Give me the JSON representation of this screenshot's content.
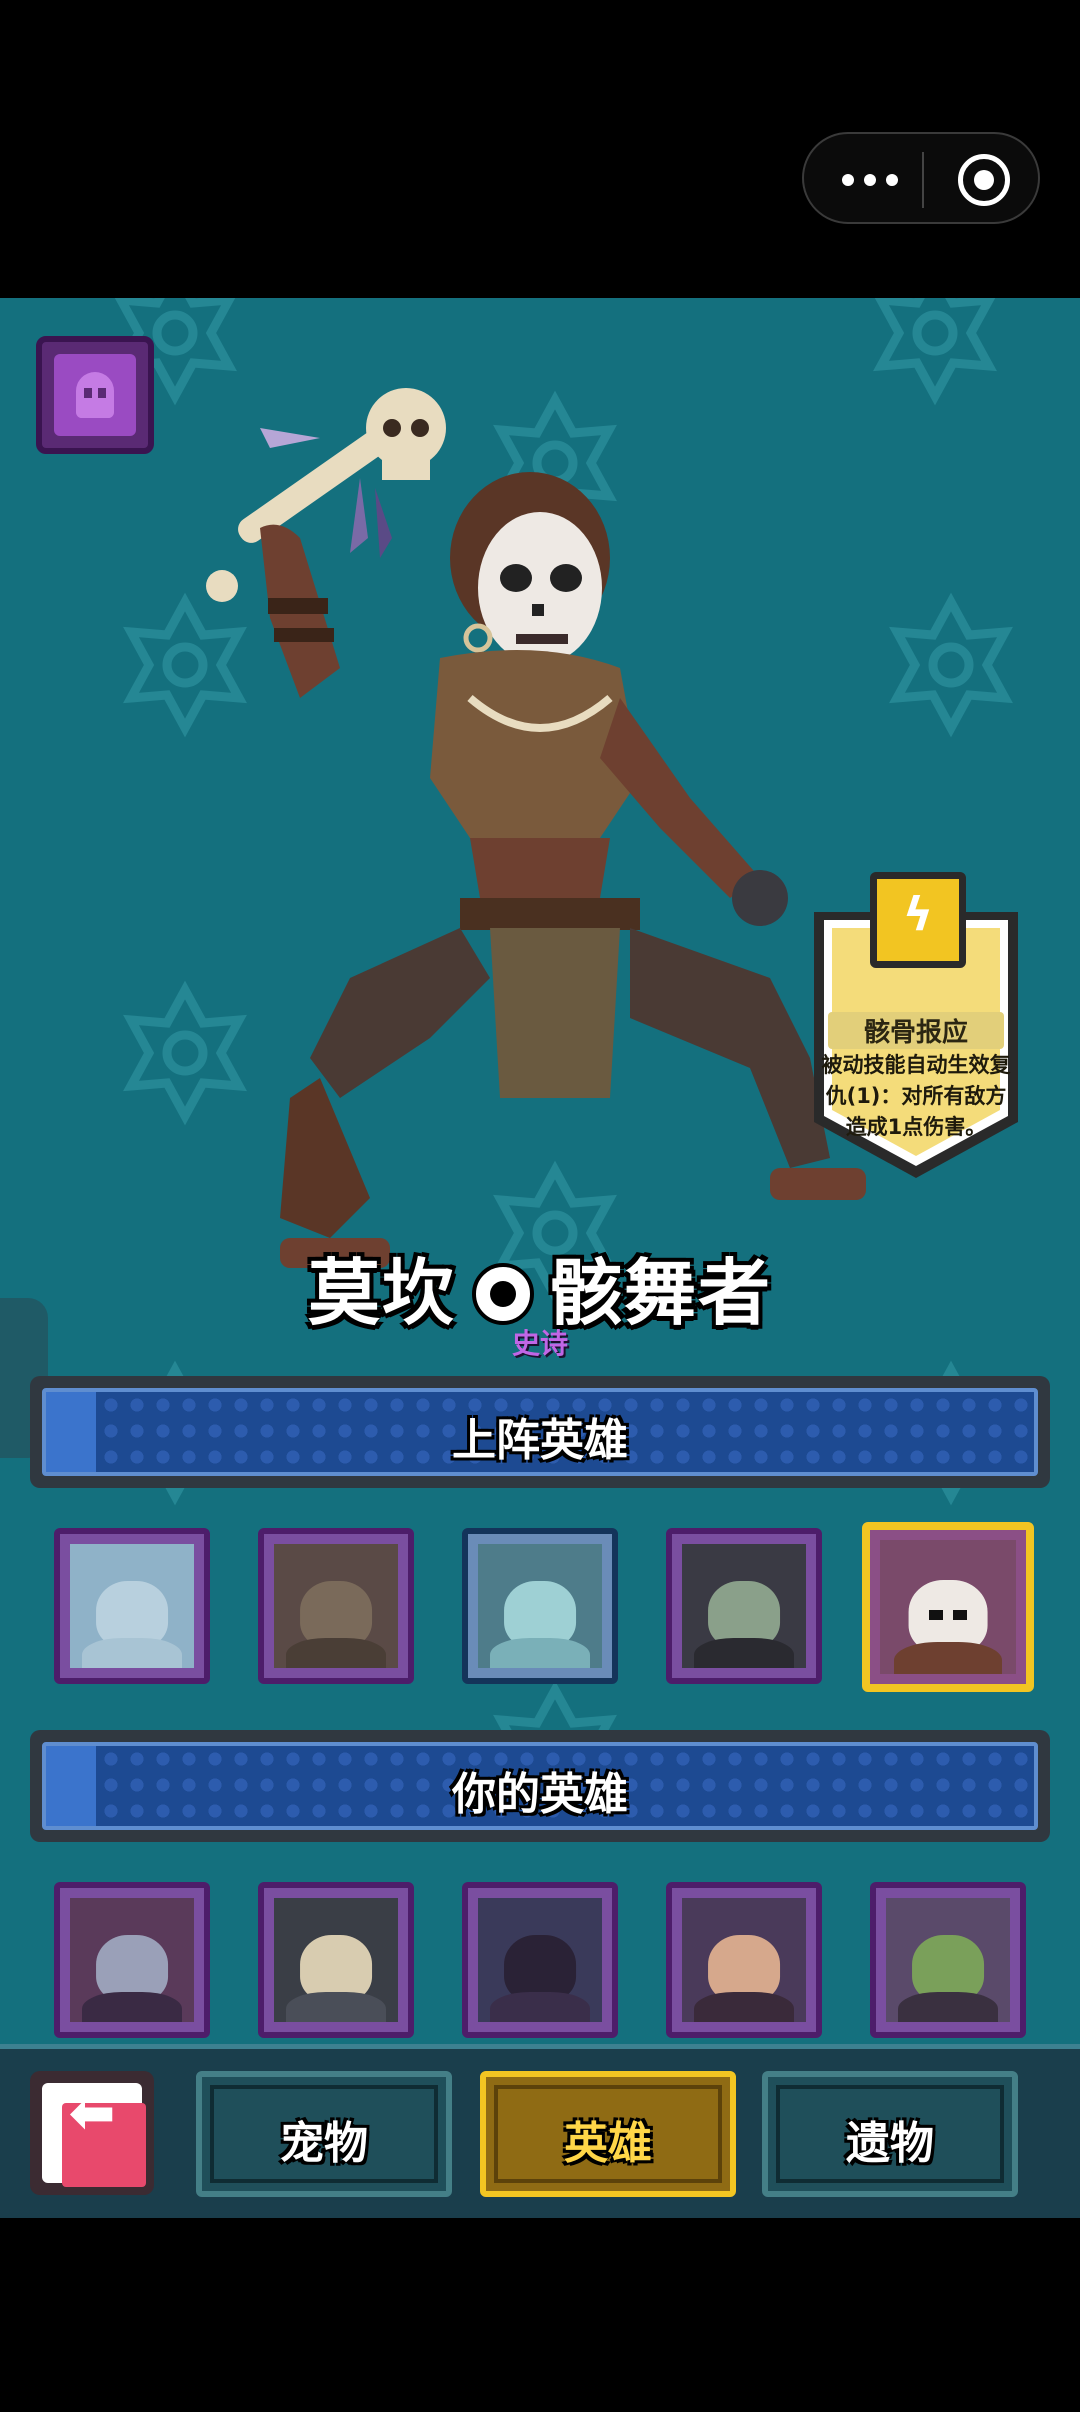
{
  "system_bar": {
    "more_icon": "more-dots-icon",
    "close_icon": "target-circle-icon"
  },
  "hero": {
    "name_part1": "莫坎",
    "name_part2": "骸舞者",
    "rarity": "史诗",
    "rarity_color": "#c066e6"
  },
  "skill": {
    "icon": "lightning-icon",
    "name": "骸骨报应",
    "description": "被动技能自动生效复仇(1)：对所有敌方造成1点伤害。"
  },
  "sections": {
    "deployed_title": "上阵英雄",
    "owned_title": "你的英雄"
  },
  "deployed_heroes": [
    {
      "id": "ghost-samurai",
      "frame": "purple",
      "selected": false
    },
    {
      "id": "horned-skeleton-warrior",
      "frame": "purple",
      "selected": false
    },
    {
      "id": "ghost-old-man",
      "frame": "blue",
      "selected": false
    },
    {
      "id": "vampire",
      "frame": "purple",
      "selected": false
    },
    {
      "id": "bone-dancer",
      "frame": "gold",
      "selected": true
    }
  ],
  "owned_heroes": [
    {
      "id": "dark-elf-woman",
      "frame": "purple"
    },
    {
      "id": "skeleton-knight",
      "frame": "purple"
    },
    {
      "id": "hooded-wraith",
      "frame": "purple"
    },
    {
      "id": "dark-haired-woman",
      "frame": "purple"
    },
    {
      "id": "green-witch",
      "frame": "purple"
    }
  ],
  "bottom_nav": {
    "back_icon": "back-arrow-icon",
    "tabs": [
      {
        "label": "宠物",
        "active": false
      },
      {
        "label": "英雄",
        "active": true
      },
      {
        "label": "遗物",
        "active": false
      }
    ]
  },
  "colors": {
    "background": "#14707e",
    "accent_gold": "#f2c522",
    "section_blue": "#1d4a92"
  }
}
